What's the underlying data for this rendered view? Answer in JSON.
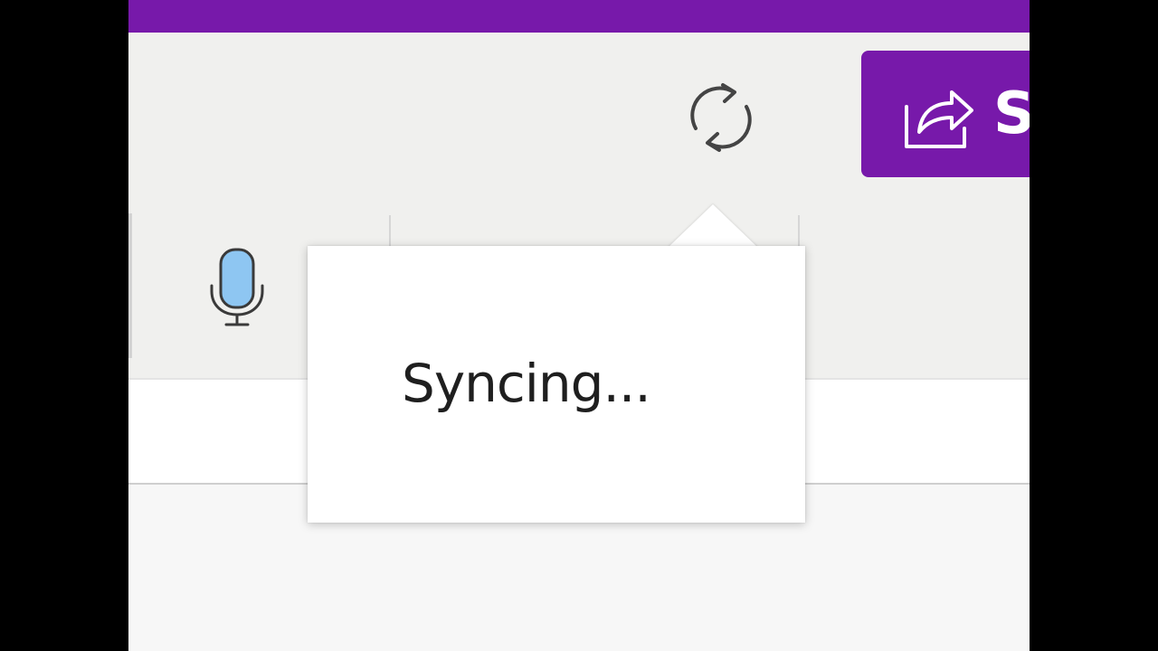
{
  "header": {
    "sync": {
      "icon": "sync-icon"
    },
    "share": {
      "label": "S",
      "icon": "share-icon"
    }
  },
  "ribbon": {
    "dictate": {
      "icon": "microphone-icon"
    }
  },
  "tooltip": {
    "text": "Syncing..."
  },
  "colors": {
    "brand": "#7719aa",
    "toolbar_bg": "#f0f0ee",
    "page_bg": "#f7f7f7",
    "mic_fill": "#8ec6f2",
    "icon_stroke": "#444444"
  }
}
